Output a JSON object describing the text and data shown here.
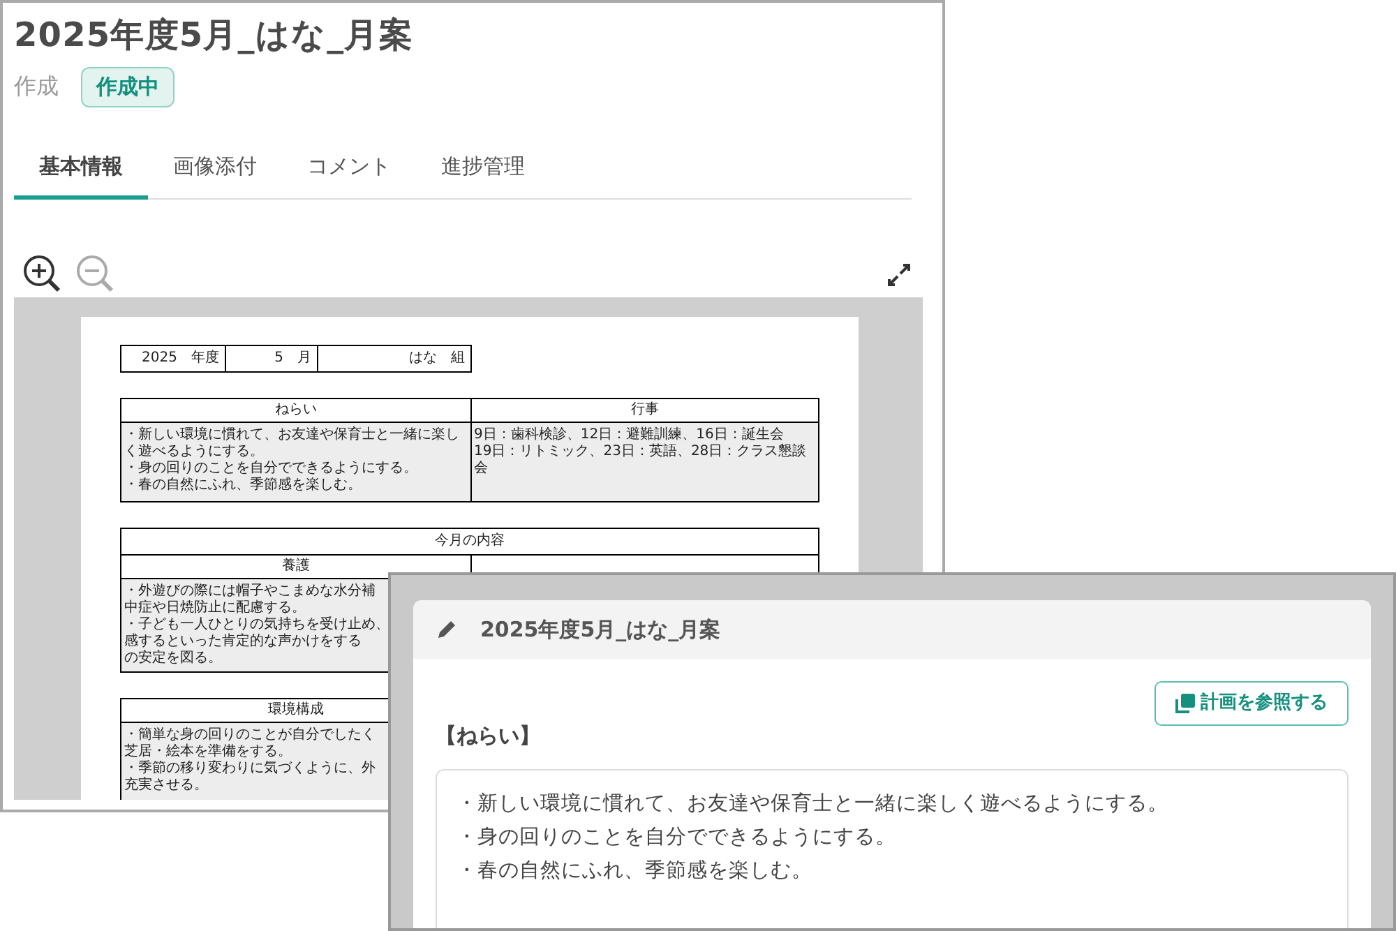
{
  "main_window": {
    "title": "2025年度5月_はな_月案",
    "status_label": "作成",
    "status_badge": "作成中",
    "tabs": [
      {
        "label": "基本情報",
        "selected": true
      },
      {
        "label": "画像添付",
        "selected": false
      },
      {
        "label": "コメント",
        "selected": false
      },
      {
        "label": "進捗管理",
        "selected": false
      }
    ],
    "document": {
      "header_cells": [
        "2025　年度",
        "5　月",
        "はな　組"
      ],
      "sections": [
        {
          "columns": [
            {
              "header": "ねらい",
              "lines": [
                "・新しい環境に慣れて、お友達や保育士と一緒に楽しく遊べるようにする。",
                "・身の回りのことを自分でできるようにする。",
                "・春の自然にふれ、季節感を楽しむ。"
              ]
            },
            {
              "header": "行事",
              "lines": [
                "9日：歯科検診、12日：避難訓練、16日：誕生会",
                "19日：リトミック、23日：英語、28日：クラス懇談会"
              ]
            }
          ]
        },
        {
          "title": "今月の内容",
          "columns": [
            {
              "header": "養護",
              "lines": [
                "・外遊びの際には帽子やこまめな水分補",
                "中症や日焼防止に配慮する。",
                "・子ども一人ひとりの気持ちを受け止め、",
                "感するといった肯定的な声かけをする",
                "の安定を図る。"
              ]
            }
          ]
        },
        {
          "columns": [
            {
              "header": "環境構成",
              "lines": [
                "・簡単な身の回りのことが自分でしたく",
                "芝居・絵本を準備をする。",
                "・季節の移り変わりに気づくように、外",
                "充実させる。"
              ]
            }
          ]
        }
      ]
    }
  },
  "dialog": {
    "title": "2025年度5月_はな_月案",
    "reference_button": "計画を参照する",
    "field_label": "【ねらい】",
    "field_lines": [
      "・新しい環境に慣れて、お友達や保育士と一緒に楽しく遊べるようにする。",
      "・身の回りのことを自分でできるようにする。",
      "・春の自然にふれ、季節感を楽しむ。"
    ]
  }
}
